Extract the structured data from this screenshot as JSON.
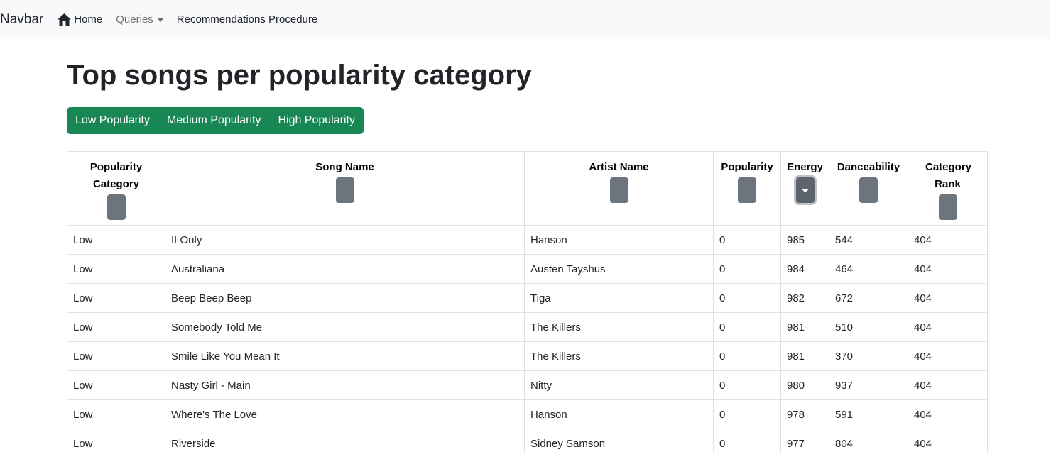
{
  "navbar": {
    "brand": "Navbar",
    "home_label": "Home",
    "queries_label": "Queries",
    "recommendations_label": "Recommendations Procedure"
  },
  "page": {
    "title": "Top songs per popularity category"
  },
  "filters": {
    "low": "Low Popularity",
    "medium": "Medium Popularity",
    "high": "High Popularity"
  },
  "colors": {
    "accent": "#198754",
    "sort_button": "#6c757d",
    "navbar_bg": "#f8f9fa"
  },
  "table": {
    "columns": [
      "Popularity Category",
      "Song Name",
      "Artist Name",
      "Popularity",
      "Energy",
      "Danceability",
      "Category Rank"
    ],
    "active_sort_column": "Energy",
    "rows": [
      [
        "Low",
        "If Only",
        "Hanson",
        "0",
        "985",
        "544",
        "404"
      ],
      [
        "Low",
        "Australiana",
        "Austen Tayshus",
        "0",
        "984",
        "464",
        "404"
      ],
      [
        "Low",
        "Beep Beep Beep",
        "Tiga",
        "0",
        "982",
        "672",
        "404"
      ],
      [
        "Low",
        "Somebody Told Me",
        "The Killers",
        "0",
        "981",
        "510",
        "404"
      ],
      [
        "Low",
        "Smile Like You Mean It",
        "The Killers",
        "0",
        "981",
        "370",
        "404"
      ],
      [
        "Low",
        "Nasty Girl - Main",
        "Nitty",
        "0",
        "980",
        "937",
        "404"
      ],
      [
        "Low",
        "Where's The Love",
        "Hanson",
        "0",
        "978",
        "591",
        "404"
      ],
      [
        "Low",
        "Riverside",
        "Sidney Samson",
        "0",
        "977",
        "804",
        "404"
      ]
    ]
  }
}
